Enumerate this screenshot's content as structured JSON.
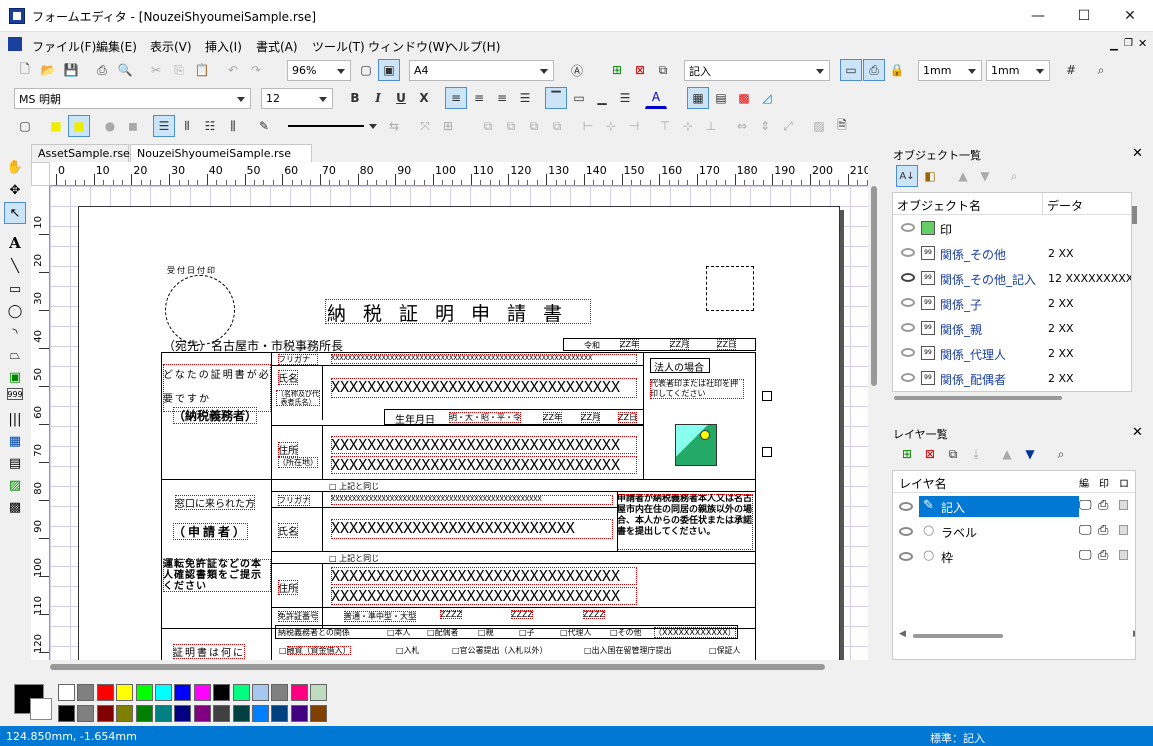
{
  "window": {
    "title": "フォームエディタ - [NouzeiShyoumeiSample.rse]",
    "min": "—",
    "max": "☐",
    "close": "✕"
  },
  "menu": [
    "ファイル(F)",
    "編集(E)",
    "表示(V)",
    "挿入(I)",
    "書式(A)",
    "ツール(T)",
    "ウィンドウ(W)",
    "ヘルプ(H)"
  ],
  "toolbar1": {
    "zoom": "96%",
    "paper": "A4",
    "layer": "記入",
    "unit1": "1mm",
    "unit2": "1mm"
  },
  "toolbar2": {
    "font": "MS 明朝",
    "size": "12",
    "bold": "B",
    "italic": "I",
    "underline": "U",
    "strike": "X"
  },
  "tabs": [
    "AssetSample.rse",
    "NouzeiShyoumeiSample.rse"
  ],
  "ruler": {
    "top": [
      "0",
      "10",
      "20",
      "30",
      "40",
      "50",
      "60",
      "70",
      "80",
      "90",
      "100",
      "110",
      "120",
      "130",
      "140",
      "150",
      "160",
      "170",
      "180",
      "190",
      "200",
      "210"
    ],
    "left": [
      "10",
      "20",
      "30",
      "40",
      "50",
      "60",
      "70",
      "80",
      "90",
      "100",
      "110",
      "120"
    ]
  },
  "form": {
    "stamp_label": "受付日付印",
    "title": "納税証明申請書",
    "addressee": "（宛先）名古屋市・市税事務所長",
    "era": "令和",
    "date_year": "ZZ年",
    "date_month": "ZZ月",
    "date_day": "ZZ日",
    "who_needs": "どなたの証明書が必要ですか",
    "taxpayer": "（納税義務者）",
    "furigana": "フリガナ",
    "furigana_value": "XXXXXXXXXXXXXXXXXXXXXXXXXXXXXXXXXXXXXXXXXXXXXXXXXXXXXXXXXXXXXX",
    "name_label": "氏名",
    "corp_name_label": "（名称及び代表者氏名）",
    "name_value": "XXXXXXXXXXXXXXXXXXXXXXXXXXXXXXXX",
    "corp_case": "法人の場合",
    "corp_seal_note": "代表者印または社印を押印してください",
    "birth_label": "生年月日",
    "birth_era": "明・大・昭・平・令",
    "birth_year": "ZZ年",
    "birth_month": "ZZ月",
    "birth_day": "ZZ日",
    "address_label": "住所",
    "address_sub": "（所在地）",
    "address_line": "XXXXXXXXXXXXXXXXXXXXXXXXXXXXXXXX",
    "same_above": "上記と同じ",
    "visitor": "窓口に来られた方",
    "applicant": "（申請者）",
    "applicant_furigana_value": "XXXXXXXXXXXXXXXXXXXXXXXXXXXXXXXXXXXXXXXXXXXXXXXXXX",
    "applicant_name_value": "XXXXXXXXXXXXXXXXXXXXXXXXXXX",
    "applicant_note": "申請者が納税義務者本人又は名古屋市内在住の同居の親族以外の場合、本人からの委任状または承諾書を提出してください。",
    "license_note": "運転免許証などの本人確認書類をご提示ください",
    "license_kind": "免許証番号",
    "license_types": "普通・準中型・大型",
    "license_z": "ZZZZ",
    "relation_label": "納税義務者との関係",
    "rel_self": "本人",
    "rel_spouse": "配偶者",
    "rel_parent": "親",
    "rel_child": "子",
    "rel_agent": "代理人",
    "rel_other": "その他",
    "rel_other_value": "（XXXXXXXXXXXX）",
    "purpose_label": "証明書は何に",
    "purpose_1": "融資（資金借入）",
    "purpose_2": "入札",
    "purpose_3": "官公署提出（入札以外）",
    "purpose_4": "出入国在留管理庁提出",
    "purpose_5": "保証人"
  },
  "objects_panel": {
    "title": "オブジェクト一覧",
    "col_name": "オブジェクト名",
    "col_data": "データ",
    "rows": [
      {
        "name": "印",
        "data": ""
      },
      {
        "name": "関係_その他",
        "data": "2 XX"
      },
      {
        "name": "関係_その他_記入",
        "data": "12 XXXXXXXXXX"
      },
      {
        "name": "関係_子",
        "data": "2 XX"
      },
      {
        "name": "関係_親",
        "data": "2 XX"
      },
      {
        "name": "関係_代理人",
        "data": "2 XX"
      },
      {
        "name": "関係_配偶者",
        "data": "2 XX"
      }
    ]
  },
  "layers_panel": {
    "title": "レイヤ一覧",
    "col_name": "レイヤ名",
    "col_edit": "編",
    "col_print": "印",
    "col_lock": "ロ",
    "rows": [
      {
        "name": "記入",
        "selected": true
      },
      {
        "name": "ラベル",
        "selected": false
      },
      {
        "name": "枠",
        "selected": false
      }
    ]
  },
  "palette": [
    "#ffffff",
    "#808080",
    "#ff0000",
    "#ffff00",
    "#00ff00",
    "#00ffff",
    "#0000ff",
    "#ff00ff",
    "#000000",
    "#00ff80",
    "#a6c8f0",
    "#808080",
    "#ff0080",
    "#c0dcc0",
    "#000000",
    "#808080",
    "#800000",
    "#808000",
    "#008000",
    "#008080",
    "#000080",
    "#800080",
    "#404040",
    "#004040",
    "#0080ff",
    "#004080",
    "#400080",
    "#804000"
  ],
  "status": {
    "coords": "124.850mm, -1.654mm",
    "mode": "標準：記入"
  }
}
